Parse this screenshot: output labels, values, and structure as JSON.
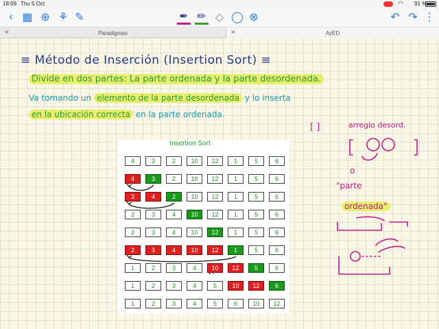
{
  "status_bar": {
    "time": "18:09",
    "date": "Thu 5 Oct",
    "battery": "91 %"
  },
  "toolbar": {
    "icons": [
      "back-icon",
      "grid-icon",
      "add-icon",
      "shapes-icon",
      "edit-icon",
      "pen-icon",
      "highlighter-icon",
      "eraser-icon",
      "lasso-icon",
      "delete-icon",
      "undo-icon",
      "redo-icon",
      "more-icon"
    ]
  },
  "tabs": [
    {
      "label": "Paradigmas",
      "active": false
    },
    {
      "label": "AyED",
      "active": true
    }
  ],
  "note": {
    "title": "≡ Método de Inserción (Insertion Sort) ≡",
    "line1_a": "Divide en dos partes: La parte ordenada y la parte desordenada.",
    "line2_a": "Va tomando un",
    "line2_hl": "elemento de la parte desordenada",
    "line2_b": "y lo inserta",
    "line3_hl": "en la ubicación correcta",
    "line3_b": "en la parte ordenada.",
    "side_bracket": "[ ]",
    "side_arreglo": "arreglo desord.",
    "side_o": "o",
    "side_parte": "\"parte",
    "side_ordenada": "ordenada\""
  },
  "figure": {
    "title": "Insertion Sort",
    "rows": [
      {
        "values": [
          4,
          3,
          2,
          10,
          12,
          1,
          5,
          6
        ],
        "red": [],
        "green": []
      },
      {
        "values": [
          4,
          3,
          2,
          10,
          12,
          1,
          5,
          6
        ],
        "red": [
          0
        ],
        "green": [
          1
        ]
      },
      {
        "values": [
          3,
          4,
          2,
          10,
          12,
          1,
          5,
          6
        ],
        "red": [
          0,
          1
        ],
        "green": [
          2
        ]
      },
      {
        "values": [
          2,
          3,
          4,
          10,
          12,
          1,
          5,
          6
        ],
        "red": [],
        "green": [
          3
        ]
      },
      {
        "values": [
          2,
          3,
          4,
          10,
          12,
          1,
          5,
          6
        ],
        "red": [],
        "green": [
          4
        ]
      },
      {
        "values": [
          2,
          3,
          4,
          10,
          12,
          1,
          5,
          6
        ],
        "red": [
          0,
          1,
          2,
          3,
          4
        ],
        "green": [
          5
        ]
      },
      {
        "values": [
          1,
          2,
          3,
          4,
          10,
          12,
          5,
          6
        ],
        "red": [
          4,
          5
        ],
        "green": [
          6
        ]
      },
      {
        "values": [
          1,
          2,
          3,
          4,
          5,
          10,
          12,
          6
        ],
        "red": [
          5,
          6
        ],
        "green": [
          7
        ]
      },
      {
        "values": [
          1,
          2,
          3,
          4,
          5,
          6,
          10,
          12
        ],
        "red": [],
        "green": []
      }
    ]
  },
  "colors": {
    "accent": "#2a7ae4",
    "red": "#e0201f",
    "green": "#1a9a1a",
    "highlight": "#e7ef6a",
    "pink_ink": "#c2188b"
  }
}
